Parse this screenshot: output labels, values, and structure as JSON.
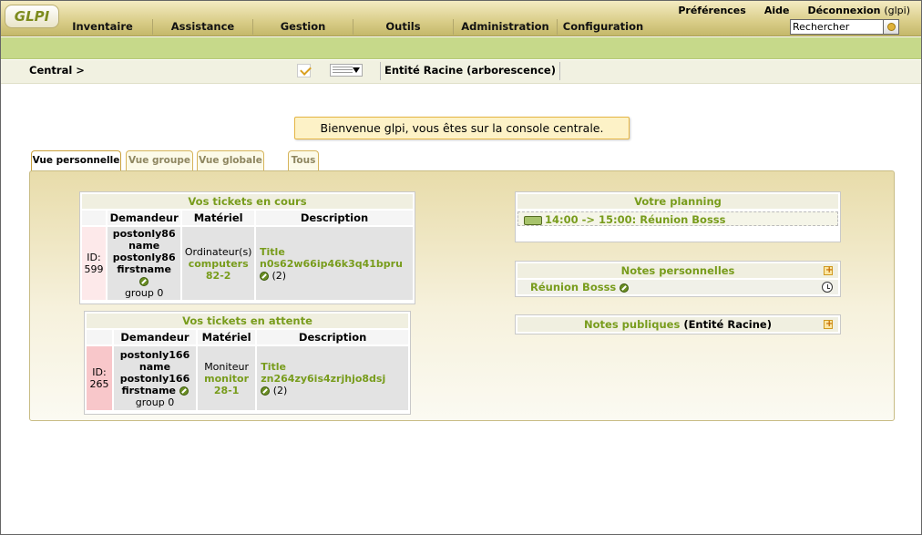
{
  "header": {
    "logo": "GLPI",
    "links": [
      {
        "label": "Préférences"
      },
      {
        "label": "Aide"
      },
      {
        "label": "Déconnexion",
        "user": "(glpi)"
      }
    ],
    "menu": [
      "Inventaire",
      "Assistance",
      "Gestion",
      "Outils",
      "Administration",
      "Configuration"
    ],
    "search": {
      "value": "Rechercher"
    }
  },
  "path": {
    "breadcrumb": "Central >",
    "entity": "Entité Racine (arborescence)"
  },
  "welcome": "Bienvenue glpi, vous êtes sur la console centrale.",
  "tabs": [
    "Vue personnelle",
    "Vue groupe",
    "Vue globale",
    "Tous"
  ],
  "tickets_in_progress": {
    "title": "Vos tickets en cours",
    "columns": [
      "Demandeur",
      "Matériel",
      "Description"
    ],
    "rows": [
      {
        "id_label": "ID:",
        "id": "599",
        "requester_line1": "postonly86",
        "requester_line2": "name",
        "requester_line3": "postonly86",
        "requester_line4": "firstname",
        "group": "group 0",
        "item_type": "Ordinateur(s)",
        "item_name": "computers",
        "item_num": "82-2",
        "desc_title": "Title",
        "desc_text": "n0s62w66ip46k3q41bpru",
        "desc_count": "(2)"
      }
    ]
  },
  "tickets_waiting": {
    "title": "Vos tickets en attente",
    "columns": [
      "Demandeur",
      "Matériel",
      "Description"
    ],
    "rows": [
      {
        "id_label": "ID:",
        "id": "265",
        "requester_line1": "postonly166",
        "requester_line2": "name",
        "requester_line3": "postonly166",
        "requester_line4": "firstname",
        "group": "group 0",
        "item_type": "Moniteur",
        "item_name": "monitor",
        "item_num": "28-1",
        "desc_title": "Title",
        "desc_text": "zn264zy6is4zrjhjo8dsj",
        "desc_count": "(2)"
      }
    ]
  },
  "planning": {
    "title": "Votre planning",
    "entry": "14:00 -> 15:00: Réunion Bosss"
  },
  "personal_notes": {
    "title": "Notes personnelles",
    "entry": "Réunion Bosss"
  },
  "public_notes": {
    "title": "Notes publiques",
    "entity": "(Entité Racine)"
  }
}
